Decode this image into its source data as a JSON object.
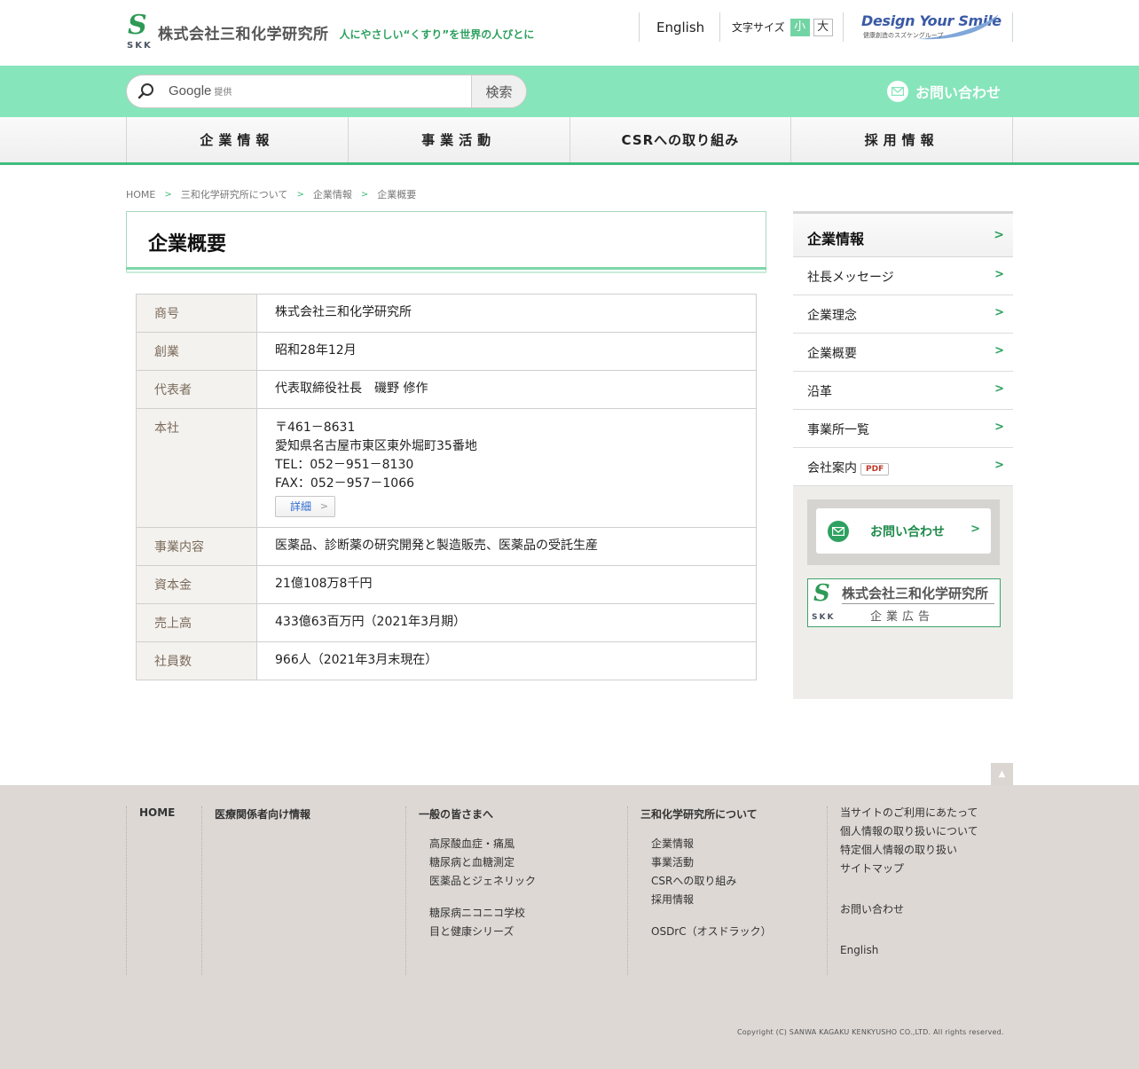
{
  "header": {
    "company_name": "株式会社三和化学研究所",
    "logo_mark": "S",
    "logo_abbr": "SKK",
    "tagline": "人にやさしい“くすり”を世界の人びとに",
    "english_link": "English",
    "font_size_label": "文字サイズ",
    "font_size_small": "小",
    "font_size_large": "大",
    "group_logo_title": "Design Your Smile",
    "group_logo_sub": "健康創造のスズケングループ"
  },
  "search": {
    "google_label": "Google",
    "google_suffix": "提供",
    "button_label": "検索",
    "contact_label": "お問い合わせ"
  },
  "gnav": {
    "items": [
      "企業情報",
      "事業活動",
      "CSRへの取り組み",
      "採用情報"
    ]
  },
  "breadcrumb": [
    "HOME",
    "三和化学研究所について",
    "企業情報",
    "企業概要"
  ],
  "main": {
    "title": "企業概要",
    "rows": [
      {
        "label": "商号",
        "value": "株式会社三和化学研究所"
      },
      {
        "label": "創業",
        "value": "昭和28年12月"
      },
      {
        "label": "代表者",
        "value": "代表取締役社長　磯野 修作"
      },
      {
        "label": "本社",
        "postal": "〒461－8631",
        "address": "愛知県名古屋市東区東外堀町35番地",
        "tel": "TEL：052－951－8130",
        "fax": "FAX：052－957－1066",
        "detail_button": "詳細"
      },
      {
        "label": "事業内容",
        "value": "医薬品、診断薬の研究開発と製造販売、医薬品の受託生産"
      },
      {
        "label": "資本金",
        "value": "21億108万8千円"
      },
      {
        "label": "売上高",
        "value": "433億63百万円（2021年3月期）"
      },
      {
        "label": "社員数",
        "value": "966人（2021年3月末現在）"
      }
    ]
  },
  "sidebar": {
    "heading": "企業情報",
    "items": [
      "社長メッセージ",
      "企業理念",
      "企業概要",
      "沿革",
      "事業所一覧",
      "会社案内"
    ],
    "pdf_badge": "PDF",
    "contact_label": "お問い合わせ",
    "ad_company": "株式会社三和化学研究所",
    "ad_sub": "企業広告",
    "ad_mark": "S",
    "ad_abbr": "SKK"
  },
  "pagetop": "▲",
  "footer": {
    "home": "HOME",
    "medical": "医療関係者向け情報",
    "general": {
      "heading": "一般の皆さまへ",
      "group1": [
        "高尿酸血症・痛風",
        "糖尿病と血糖測定",
        "医薬品とジェネリック"
      ],
      "group2": [
        "糖尿病ニコニコ学校",
        "目と健康シリーズ"
      ]
    },
    "about": {
      "heading": "三和化学研究所について",
      "group1": [
        "企業情報",
        "事業活動",
        "CSRへの取り組み",
        "採用情報"
      ],
      "group2": [
        "OSDrC（オスドラック）"
      ]
    },
    "misc": {
      "group1": [
        "当サイトのご利用にあたって",
        "個人情報の取り扱いについて",
        "特定個人情報の取り扱い",
        "サイトマップ"
      ],
      "contact": "お問い合わせ",
      "english": "English"
    },
    "copyright": "Copyright (C) SANWA KAGAKU KENKYUSHO CO.,LTD. All rights reserved."
  },
  "colors": {
    "brand_green": "#2ea160",
    "search_bar": "#86e5bb",
    "nav_underline": "#3ebd7f",
    "footer_bg": "#ddd8d4",
    "table_header_bg": "#f4f2ef",
    "link_blue": "#2e6bd1"
  }
}
